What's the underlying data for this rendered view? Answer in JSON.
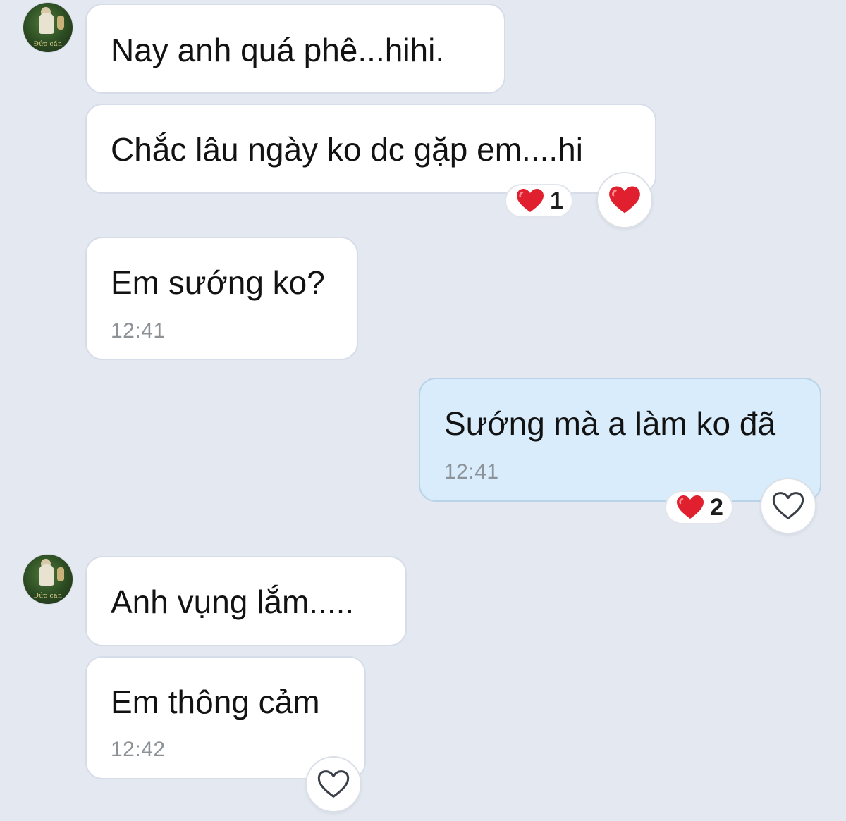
{
  "avatar": {
    "caption": "Đức cần"
  },
  "messages": [
    {
      "text": "Nay anh quá phê...hihi.",
      "time": ""
    },
    {
      "text": "Chắc lâu ngày ko dc gặp em....hi",
      "time": ""
    },
    {
      "text": "Em sướng ko?",
      "time": "12:41"
    },
    {
      "text": "Sướng mà a làm ko đã",
      "time": "12:41"
    },
    {
      "text": "Anh vụng lắm.....",
      "time": ""
    },
    {
      "text": "Em thông cảm",
      "time": "12:42"
    }
  ],
  "reactions": {
    "msg2_count": "1",
    "msg4_count": "2"
  },
  "colors": {
    "background": "#e3e8f1",
    "incoming_bubble": "#ffffff",
    "outgoing_bubble": "#d8ecfb",
    "heart": "#e0202e",
    "timestamp": "#8c9298"
  },
  "icons": {
    "filled_heart": "heart-filled-icon",
    "outline_heart": "heart-outline-icon"
  }
}
